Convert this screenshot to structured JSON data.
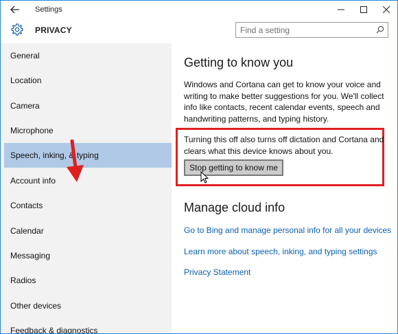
{
  "window": {
    "title": "Settings"
  },
  "header": {
    "title": "PRIVACY",
    "search_placeholder": "Find a setting"
  },
  "sidebar": {
    "items": [
      {
        "label": "General"
      },
      {
        "label": "Location"
      },
      {
        "label": "Camera"
      },
      {
        "label": "Microphone"
      },
      {
        "label": "Speech, inking, & typing",
        "active": true
      },
      {
        "label": "Account info"
      },
      {
        "label": "Contacts"
      },
      {
        "label": "Calendar"
      },
      {
        "label": "Messaging"
      },
      {
        "label": "Radios"
      },
      {
        "label": "Other devices"
      },
      {
        "label": "Feedback & diagnostics"
      }
    ]
  },
  "main": {
    "section1_title": "Getting to know you",
    "section1_desc": "Windows and Cortana can get to know your voice and writing to make better suggestions for you. We'll collect info like contacts, recent calendar events, speech and handwriting patterns, and typing history.",
    "warning_text": "Turning this off also turns off dictation and Cortana and clears what this device knows about you.",
    "stop_button_label": "Stop getting to know me",
    "section2_title": "Manage cloud info",
    "links": [
      {
        "label": "Go to Bing and manage personal info for all your devices"
      },
      {
        "label": "Learn more about speech, inking, and typing settings"
      },
      {
        "label": "Privacy Statement"
      }
    ]
  },
  "colors": {
    "accent": "#2b87d8",
    "sidebar_bg": "#f2f2f2",
    "sidebar_active": "#b0c9e6",
    "highlight": "#e02020",
    "link": "#0b5fb4"
  }
}
